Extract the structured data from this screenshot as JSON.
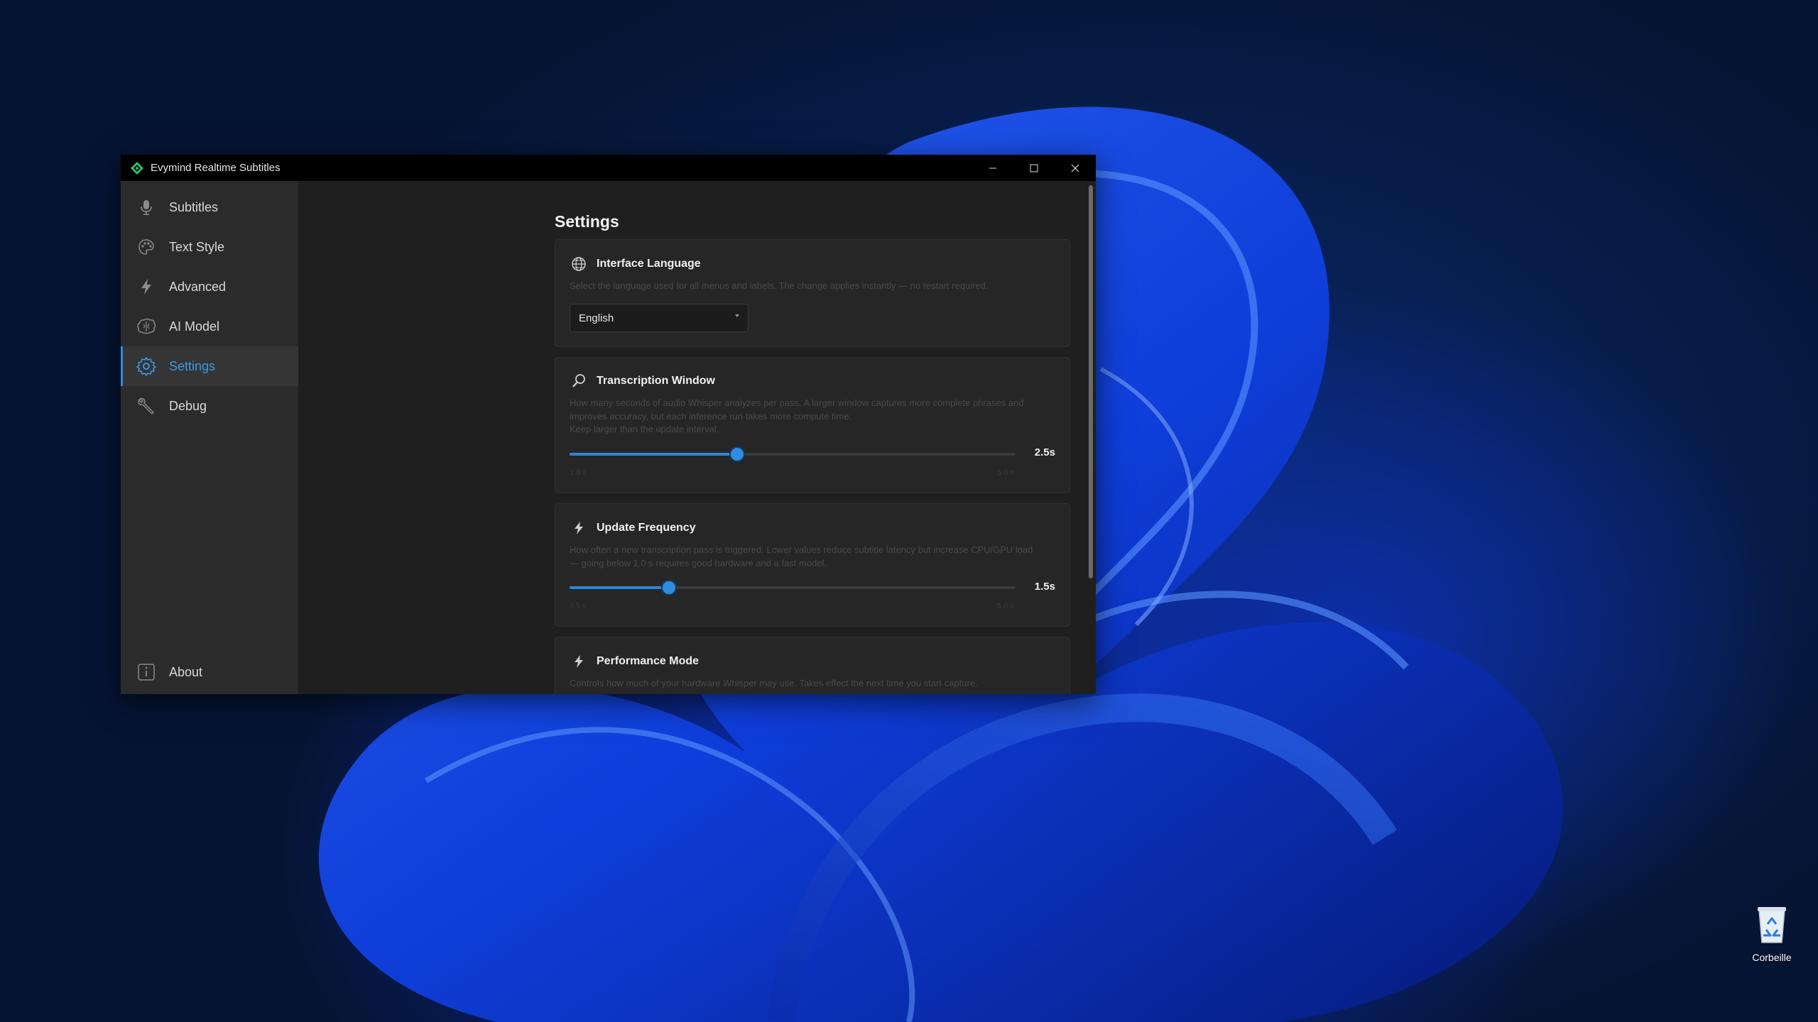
{
  "window": {
    "title": "Evymind Realtime Subtitles"
  },
  "sidebar": {
    "items": [
      {
        "label": "Subtitles",
        "icon": "microphone-icon"
      },
      {
        "label": "Text Style",
        "icon": "palette-icon"
      },
      {
        "label": "Advanced",
        "icon": "lightning-icon"
      },
      {
        "label": "AI Model",
        "icon": "brain-icon"
      },
      {
        "label": "Settings",
        "icon": "gear-icon",
        "active": true
      },
      {
        "label": "Debug",
        "icon": "wrench-icon"
      }
    ],
    "footer": {
      "label": "About",
      "icon": "info-icon"
    }
  },
  "main": {
    "title": "Settings",
    "language": {
      "title": "Interface Language",
      "description": "Select the language used for all menus and labels. The change applies instantly — no restart required.",
      "selected": "English"
    },
    "transcription": {
      "title": "Transcription Window",
      "description": "How many seconds of audio Whisper analyzes per pass. A larger window captures more complete phrases and improves accuracy, but each inference run takes more compute time.",
      "description2": "Keep larger than the update interval.",
      "value": 2.5,
      "value_label": "2.5s",
      "min": 1.0,
      "max": 5.0,
      "min_label": "1.0 s",
      "max_label": "5.0 s"
    },
    "update_frequency": {
      "title": "Update Frequency",
      "description": "How often a new transcription pass is triggered. Lower values reduce subtitle latency but increase CPU/GPU load — going below 1.0 s requires good hardware and a fast model.",
      "value": 1.5,
      "value_label": "1.5s",
      "min": 0.5,
      "max": 5.0,
      "min_label": "0.5 s",
      "max_label": "5.0 s"
    },
    "performance": {
      "title": "Performance Mode",
      "description": "Controls how much of your hardware Whisper may use. Takes effect the next time you start capture."
    }
  },
  "desktop": {
    "recycle_bin_label": "Corbeille"
  },
  "colors": {
    "accent": "#2d8ae0",
    "window_bg": "#1f1f1f",
    "sidebar_bg": "#2b2b2b",
    "titlebar_bg": "#000000"
  }
}
